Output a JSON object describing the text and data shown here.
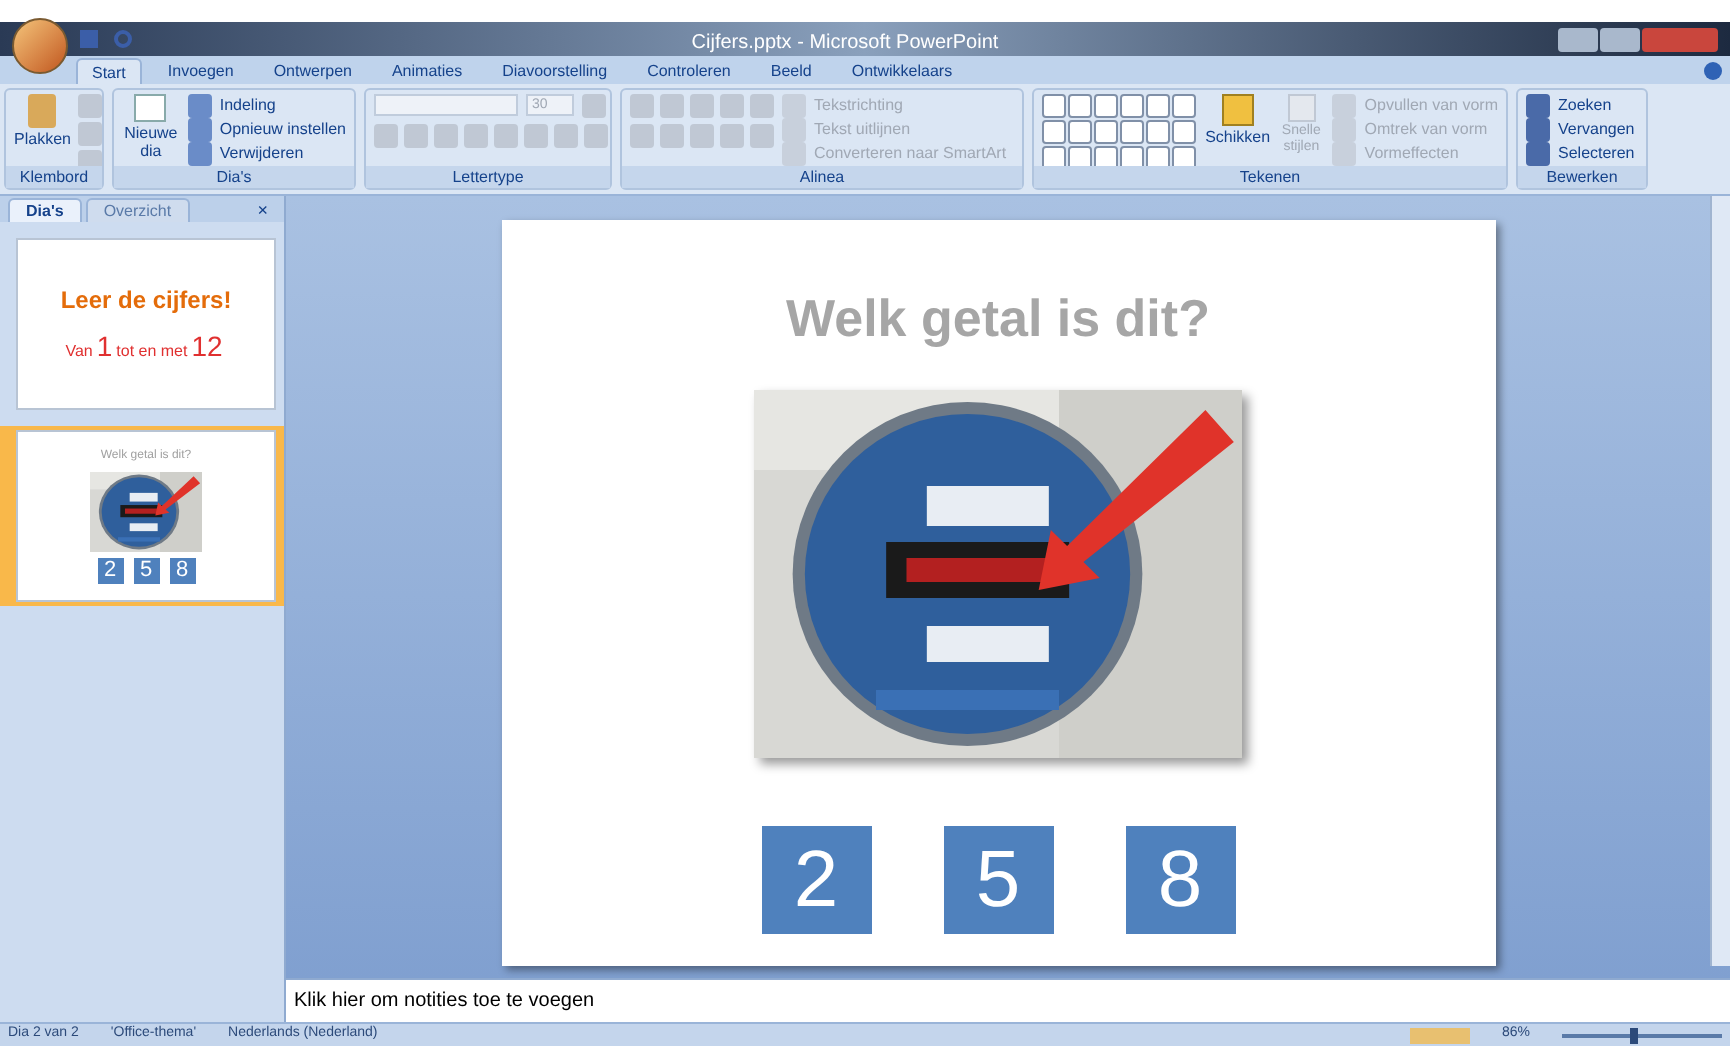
{
  "window": {
    "title": "Cijfers.pptx - Microsoft PowerPoint"
  },
  "ribbon_tabs": [
    {
      "label": "Start",
      "selected": true
    },
    {
      "label": "Invoegen",
      "selected": false
    },
    {
      "label": "Ontwerpen",
      "selected": false
    },
    {
      "label": "Animaties",
      "selected": false
    },
    {
      "label": "Diavoorstelling",
      "selected": false
    },
    {
      "label": "Controleren",
      "selected": false
    },
    {
      "label": "Beeld",
      "selected": false
    },
    {
      "label": "Ontwikkelaars",
      "selected": false
    }
  ],
  "groups": {
    "klembord": {
      "label": "Klembord",
      "paste": "Plakken"
    },
    "dias": {
      "label": "Dia's",
      "new_slide": "Nieuwe dia",
      "small": [
        {
          "label": "Indeling",
          "disabled": false
        },
        {
          "label": "Opnieuw instellen",
          "disabled": false
        },
        {
          "label": "Verwijderen",
          "disabled": false
        }
      ]
    },
    "lettertype": {
      "label": "Lettertype",
      "size": "30"
    },
    "alinea": {
      "label": "Alinea",
      "small": [
        {
          "label": "Tekstrichting",
          "disabled": true
        },
        {
          "label": "Tekst uitlijnen",
          "disabled": true
        },
        {
          "label": "Converteren naar SmartArt",
          "disabled": true
        }
      ]
    },
    "tekenen": {
      "label": "Tekenen",
      "arrange": "Schikken",
      "quick_styles": "Snelle stijlen",
      "small": [
        {
          "label": "Opvullen van vorm",
          "disabled": true
        },
        {
          "label": "Omtrek van vorm",
          "disabled": true
        },
        {
          "label": "Vormeffecten",
          "disabled": true
        }
      ]
    },
    "bewerken": {
      "label": "Bewerken",
      "small": [
        {
          "label": "Zoeken",
          "disabled": false
        },
        {
          "label": "Vervangen",
          "disabled": false
        },
        {
          "label": "Selecteren",
          "disabled": false
        }
      ]
    }
  },
  "panel_close": "×",
  "panel_tabs": [
    {
      "label": "Dia's",
      "selected": true
    },
    {
      "label": "Overzicht",
      "selected": false
    }
  ],
  "thumbnails": [
    {
      "kind": "title",
      "selected": false,
      "title": "Leer de cijfers!",
      "subtitle": [
        {
          "text": "Van",
          "big": false
        },
        {
          "text": "1",
          "big": true
        },
        {
          "text": "tot en met",
          "big": false
        },
        {
          "text": "12",
          "big": true
        }
      ]
    },
    {
      "kind": "question",
      "selected": true,
      "title": "Welk getal is dit?",
      "answers": [
        "2",
        "5",
        "8"
      ]
    }
  ],
  "slide": {
    "title": "Welk getal is dit?",
    "answers": [
      "2",
      "5",
      "8"
    ]
  },
  "notes": {
    "placeholder": "Klik hier om notities toe te voegen"
  },
  "status_bar": {
    "slide": "Dia 2 van 2",
    "theme": "'Office-thema'",
    "language": "Nederlands (Nederland)",
    "zoom": "86%",
    "zoom_slider": {
      "level": 0.45
    }
  }
}
